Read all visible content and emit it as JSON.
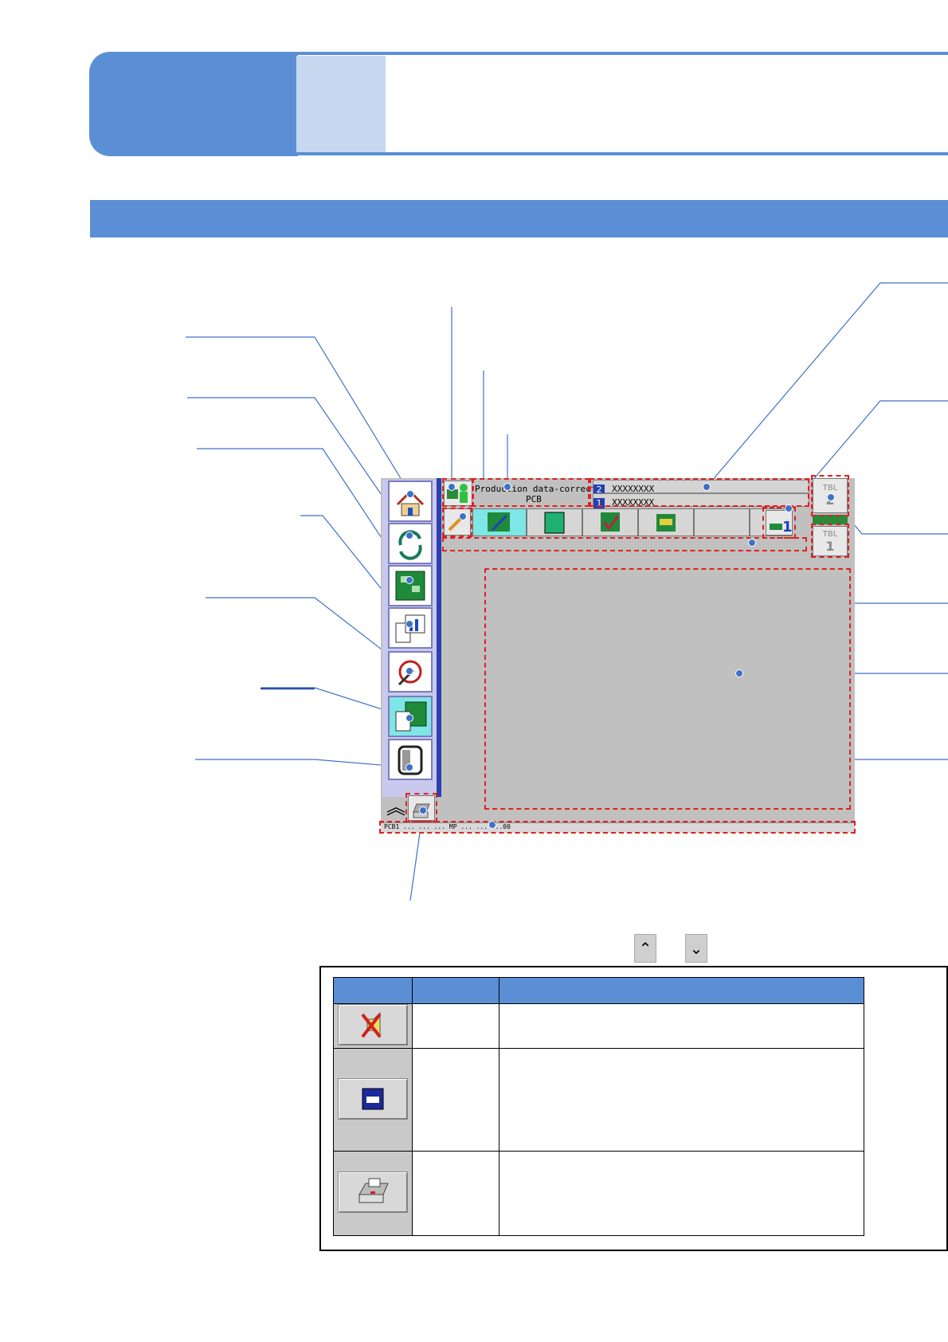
{
  "screen": {
    "production_title": "Production data-correct",
    "production_sub": "PCB",
    "lane_2_name": "XXXXXXXX",
    "lane_1_name": "XXXXXXXX",
    "lane_2_badge": "2",
    "lane_1_badge": "1",
    "table_2_label": "TBL",
    "table_2_num": "2",
    "table_1_label": "TBL",
    "table_1_num": "1",
    "status_bar_text": "PCB1 ... ... ...         MP ... ...        ...00"
  },
  "nav_arrows": {
    "up": "⌃",
    "down": "⌄"
  },
  "legend_table": {
    "headers": [
      "",
      "",
      ""
    ],
    "rows": [
      {
        "icon": "buzzer-off-icon",
        "name": "",
        "desc": ""
      },
      {
        "icon": "chip-icon",
        "name": "",
        "desc": ""
      },
      {
        "icon": "printer-icon",
        "name": "",
        "desc": ""
      }
    ]
  },
  "colors": {
    "accent": "#5a8fd5",
    "accent_light": "#c5d8f0",
    "callout_red": "#e02020",
    "screen_gray": "#c0c0c0"
  }
}
